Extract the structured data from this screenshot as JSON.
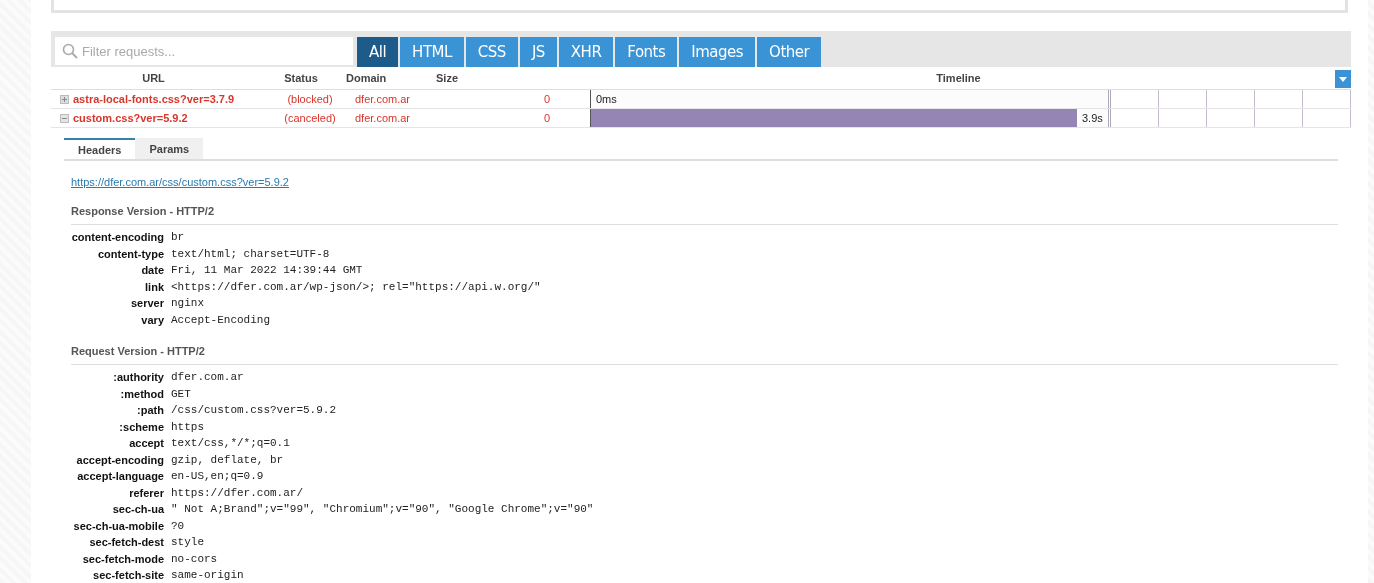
{
  "filter": {
    "placeholder": "Filter requests..."
  },
  "type_tabs": [
    {
      "label": "All",
      "selected": true
    },
    {
      "label": "HTML",
      "selected": false
    },
    {
      "label": "CSS",
      "selected": false
    },
    {
      "label": "JS",
      "selected": false
    },
    {
      "label": "XHR",
      "selected": false
    },
    {
      "label": "Fonts",
      "selected": false
    },
    {
      "label": "Images",
      "selected": false
    },
    {
      "label": "Other",
      "selected": false
    }
  ],
  "table": {
    "columns": [
      "URL",
      "Status",
      "Domain",
      "Size",
      "Timeline"
    ],
    "rows": [
      {
        "expanded": false,
        "url": "astra-local-fonts.css?ver=3.7.9",
        "status": "(blocked)",
        "domain": "dfer.com.ar",
        "size": "0",
        "level": 0,
        "time": "0ms"
      },
      {
        "expanded": true,
        "url": "custom.css?ver=5.9.2",
        "status": "(canceled)",
        "domain": "dfer.com.ar",
        "size": "0",
        "level": 0.94,
        "time": "3.9s"
      }
    ]
  },
  "detail_tabs": [
    {
      "label": "Headers",
      "selected": true
    },
    {
      "label": "Params",
      "selected": false
    }
  ],
  "request_url": "https://dfer.com.ar/css/custom.css?ver=5.9.2",
  "sections": [
    {
      "title": "Response Version - HTTP/2",
      "headers": [
        {
          "name": "content-encoding",
          "value": "br"
        },
        {
          "name": "content-type",
          "value": "text/html; charset=UTF-8"
        },
        {
          "name": "date",
          "value": "Fri, 11 Mar 2022 14:39:44 GMT"
        },
        {
          "name": "link",
          "value": "<https://dfer.com.ar/wp-json/>; rel=\"https://api.w.org/\""
        },
        {
          "name": "server",
          "value": "nginx"
        },
        {
          "name": "vary",
          "value": "Accept-Encoding"
        }
      ]
    },
    {
      "title": "Request Version - HTTP/2",
      "headers": [
        {
          "name": ":authority",
          "value": "dfer.com.ar"
        },
        {
          "name": ":method",
          "value": "GET"
        },
        {
          "name": ":path",
          "value": "/css/custom.css?ver=5.9.2"
        },
        {
          "name": ":scheme",
          "value": "https"
        },
        {
          "name": "accept",
          "value": "text/css,*/*;q=0.1"
        },
        {
          "name": "accept-encoding",
          "value": "gzip, deflate, br"
        },
        {
          "name": "accept-language",
          "value": "en-US,en;q=0.9"
        },
        {
          "name": "referer",
          "value": "https://dfer.com.ar/"
        },
        {
          "name": "sec-ch-ua",
          "value": "\" Not A;Brand\";v=\"99\", \"Chromium\";v=\"90\", \"Google Chrome\";v=\"90\""
        },
        {
          "name": "sec-ch-ua-mobile",
          "value": "?0"
        },
        {
          "name": "sec-fetch-dest",
          "value": "style"
        },
        {
          "name": "sec-fetch-mode",
          "value": "no-cors"
        },
        {
          "name": "sec-fetch-site",
          "value": "same-origin"
        }
      ]
    }
  ]
}
